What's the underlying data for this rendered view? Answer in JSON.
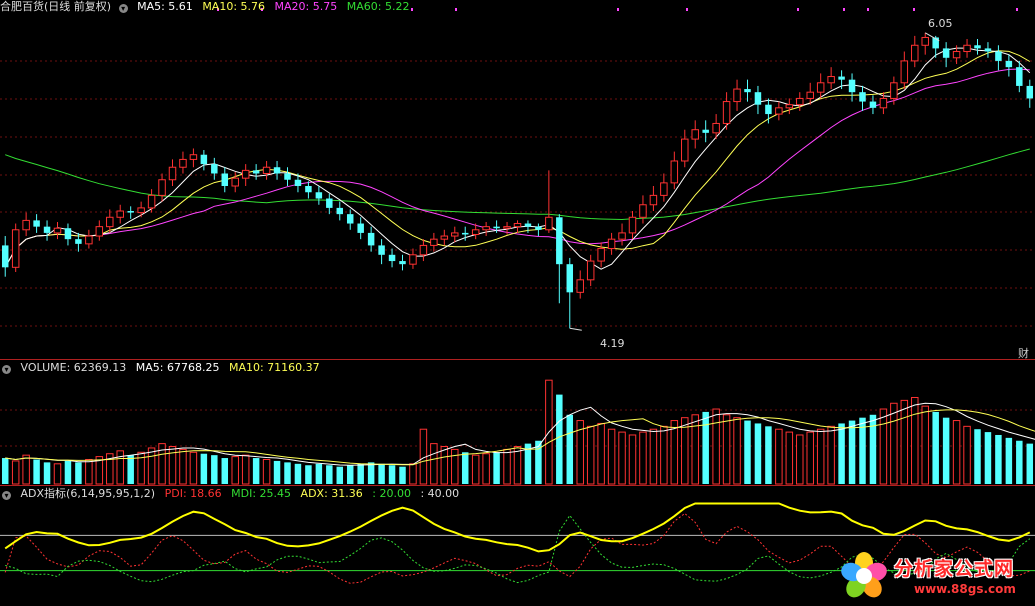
{
  "colors": {
    "bg": "#000000",
    "up": "#ff3232",
    "down": "#54ffff",
    "ma5": "#ffffff",
    "ma10": "#ffff55",
    "ma20": "#ff44ff",
    "ma60": "#33dd33",
    "grid": "#6e1010",
    "adx": "#ffff00",
    "pdi": "#ff3232",
    "mdi": "#33dd33",
    "ref": "#bbbbbb"
  },
  "price_panel": {
    "title": "合肥百货(日线 前复权)",
    "ma5": "MA5: 5.61",
    "ma10": "MA10: 5.76",
    "ma20": "MA20: 5.75",
    "ma60": "MA60: 5.22",
    "high_label": "6.05",
    "low_label": "4.19",
    "side_tab": "财"
  },
  "volume_panel": {
    "volume": "VOLUME: 62369.13",
    "ma5": "MA5: 67768.25",
    "ma10": "MA10: 71160.37"
  },
  "adx_panel": {
    "name": "ADX指标(6,14,95,95,1,2)",
    "pdi": "PDI: 18.66",
    "mdi": "MDI: 25.45",
    "adx": "ADX: 31.36",
    "lvl1": ": 20.00",
    "lvl2": ": 40.00"
  },
  "watermark": {
    "text": "分析家公式网",
    "url": "www.88gs.com"
  },
  "chart_data": {
    "type": "candlestick",
    "price_range": [
      4.0,
      6.2
    ],
    "candles": [
      [
        4.72,
        4.58,
        4.78,
        4.52
      ],
      [
        4.58,
        4.82,
        4.86,
        4.55
      ],
      [
        4.82,
        4.88,
        4.93,
        4.78
      ],
      [
        4.88,
        4.84,
        4.92,
        4.8
      ],
      [
        4.84,
        4.8,
        4.88,
        4.75
      ],
      [
        4.8,
        4.83,
        4.87,
        4.76
      ],
      [
        4.83,
        4.76,
        4.86,
        4.72
      ],
      [
        4.76,
        4.73,
        4.8,
        4.68
      ],
      [
        4.73,
        4.78,
        4.82,
        4.7
      ],
      [
        4.78,
        4.84,
        4.88,
        4.75
      ],
      [
        4.84,
        4.9,
        4.95,
        4.8
      ],
      [
        4.9,
        4.94,
        4.98,
        4.86
      ],
      [
        4.94,
        4.93,
        4.97,
        4.89
      ],
      [
        4.93,
        4.96,
        5.0,
        4.9
      ],
      [
        4.96,
        5.04,
        5.08,
        4.93
      ],
      [
        5.04,
        5.14,
        5.18,
        5.0
      ],
      [
        5.14,
        5.22,
        5.27,
        5.1
      ],
      [
        5.22,
        5.27,
        5.32,
        5.18
      ],
      [
        5.27,
        5.3,
        5.34,
        5.22
      ],
      [
        5.3,
        5.24,
        5.33,
        5.2
      ],
      [
        5.24,
        5.18,
        5.28,
        5.14
      ],
      [
        5.18,
        5.1,
        5.22,
        5.06
      ],
      [
        5.1,
        5.15,
        5.19,
        5.06
      ],
      [
        5.15,
        5.2,
        5.24,
        5.1
      ],
      [
        5.2,
        5.18,
        5.24,
        5.14
      ],
      [
        5.18,
        5.22,
        5.26,
        5.14
      ],
      [
        5.22,
        5.18,
        5.26,
        5.14
      ],
      [
        5.18,
        5.14,
        5.22,
        5.1
      ],
      [
        5.14,
        5.1,
        5.18,
        5.06
      ],
      [
        5.1,
        5.06,
        5.13,
        5.02
      ],
      [
        5.06,
        5.02,
        5.1,
        4.98
      ],
      [
        5.02,
        4.96,
        5.05,
        4.92
      ],
      [
        4.96,
        4.92,
        5.0,
        4.88
      ],
      [
        4.92,
        4.86,
        4.95,
        4.82
      ],
      [
        4.86,
        4.8,
        4.9,
        4.76
      ],
      [
        4.8,
        4.72,
        4.84,
        4.68
      ],
      [
        4.72,
        4.66,
        4.76,
        4.6
      ],
      [
        4.66,
        4.62,
        4.7,
        4.58
      ],
      [
        4.62,
        4.6,
        4.66,
        4.56
      ],
      [
        4.6,
        4.66,
        4.7,
        4.57
      ],
      [
        4.66,
        4.72,
        4.76,
        4.62
      ],
      [
        4.72,
        4.76,
        4.8,
        4.68
      ],
      [
        4.76,
        4.78,
        4.82,
        4.72
      ],
      [
        4.78,
        4.8,
        4.84,
        4.74
      ],
      [
        4.8,
        4.79,
        4.84,
        4.75
      ],
      [
        4.79,
        4.82,
        4.86,
        4.76
      ],
      [
        4.82,
        4.84,
        4.87,
        4.78
      ],
      [
        4.84,
        4.83,
        4.88,
        4.8
      ],
      [
        4.83,
        4.84,
        4.87,
        4.79
      ],
      [
        4.84,
        4.86,
        4.88,
        4.8
      ],
      [
        4.86,
        4.84,
        4.88,
        4.8
      ],
      [
        4.84,
        4.82,
        4.86,
        4.78
      ],
      [
        4.82,
        4.9,
        5.2,
        4.8
      ],
      [
        4.9,
        4.6,
        4.92,
        4.35
      ],
      [
        4.6,
        4.42,
        4.64,
        4.19
      ],
      [
        4.42,
        4.5,
        4.56,
        4.38
      ],
      [
        4.5,
        4.62,
        4.66,
        4.46
      ],
      [
        4.62,
        4.7,
        4.74,
        4.58
      ],
      [
        4.7,
        4.76,
        4.8,
        4.66
      ],
      [
        4.76,
        4.8,
        4.86,
        4.72
      ],
      [
        4.8,
        4.9,
        4.94,
        4.76
      ],
      [
        4.9,
        4.98,
        5.04,
        4.86
      ],
      [
        4.98,
        5.04,
        5.1,
        4.94
      ],
      [
        5.04,
        5.12,
        5.18,
        5.0
      ],
      [
        5.12,
        5.26,
        5.32,
        5.08
      ],
      [
        5.26,
        5.4,
        5.46,
        5.22
      ],
      [
        5.4,
        5.46,
        5.52,
        5.34
      ],
      [
        5.46,
        5.44,
        5.52,
        5.38
      ],
      [
        5.44,
        5.5,
        5.56,
        5.4
      ],
      [
        5.5,
        5.64,
        5.7,
        5.46
      ],
      [
        5.64,
        5.72,
        5.78,
        5.58
      ],
      [
        5.72,
        5.7,
        5.78,
        5.64
      ],
      [
        5.7,
        5.62,
        5.74,
        5.56
      ],
      [
        5.62,
        5.56,
        5.66,
        5.5
      ],
      [
        5.56,
        5.6,
        5.64,
        5.52
      ],
      [
        5.6,
        5.62,
        5.66,
        5.56
      ],
      [
        5.62,
        5.66,
        5.7,
        5.58
      ],
      [
        5.66,
        5.7,
        5.76,
        5.62
      ],
      [
        5.7,
        5.76,
        5.82,
        5.66
      ],
      [
        5.76,
        5.8,
        5.86,
        5.72
      ],
      [
        5.8,
        5.78,
        5.84,
        5.72
      ],
      [
        5.78,
        5.7,
        5.82,
        5.64
      ],
      [
        5.7,
        5.64,
        5.74,
        5.58
      ],
      [
        5.64,
        5.6,
        5.68,
        5.56
      ],
      [
        5.6,
        5.66,
        5.7,
        5.56
      ],
      [
        5.66,
        5.76,
        5.8,
        5.62
      ],
      [
        5.76,
        5.9,
        5.96,
        5.72
      ],
      [
        5.9,
        6.0,
        6.06,
        5.86
      ],
      [
        6.0,
        6.05,
        6.08,
        5.94
      ],
      [
        6.05,
        5.98,
        6.06,
        5.92
      ],
      [
        5.98,
        5.92,
        6.02,
        5.86
      ],
      [
        5.92,
        5.96,
        6.0,
        5.88
      ],
      [
        5.96,
        6.0,
        6.04,
        5.92
      ],
      [
        6.0,
        5.98,
        6.04,
        5.94
      ],
      [
        5.98,
        5.96,
        6.02,
        5.92
      ],
      [
        5.96,
        5.9,
        6.0,
        5.84
      ],
      [
        5.9,
        5.86,
        5.94,
        5.8
      ],
      [
        5.86,
        5.74,
        5.9,
        5.7
      ],
      [
        5.74,
        5.66,
        5.78,
        5.6
      ]
    ],
    "volume": [
      18,
      16,
      20,
      17,
      15,
      14,
      16,
      15,
      17,
      19,
      21,
      23,
      20,
      22,
      25,
      28,
      26,
      24,
      22,
      21,
      20,
      18,
      19,
      20,
      18,
      17,
      16,
      15,
      14,
      13,
      14,
      13,
      12,
      13,
      14,
      15,
      14,
      13,
      12,
      14,
      38,
      28,
      26,
      24,
      22,
      20,
      21,
      22,
      24,
      26,
      28,
      30,
      72,
      62,
      48,
      44,
      40,
      42,
      38,
      36,
      34,
      36,
      38,
      40,
      44,
      46,
      48,
      50,
      52,
      48,
      46,
      44,
      42,
      40,
      38,
      36,
      34,
      36,
      38,
      40,
      42,
      44,
      46,
      48,
      52,
      56,
      58,
      60,
      54,
      50,
      46,
      44,
      40,
      38,
      36,
      34,
      32,
      30,
      28,
      26
    ],
    "adx_levels": [
      20,
      40
    ]
  }
}
